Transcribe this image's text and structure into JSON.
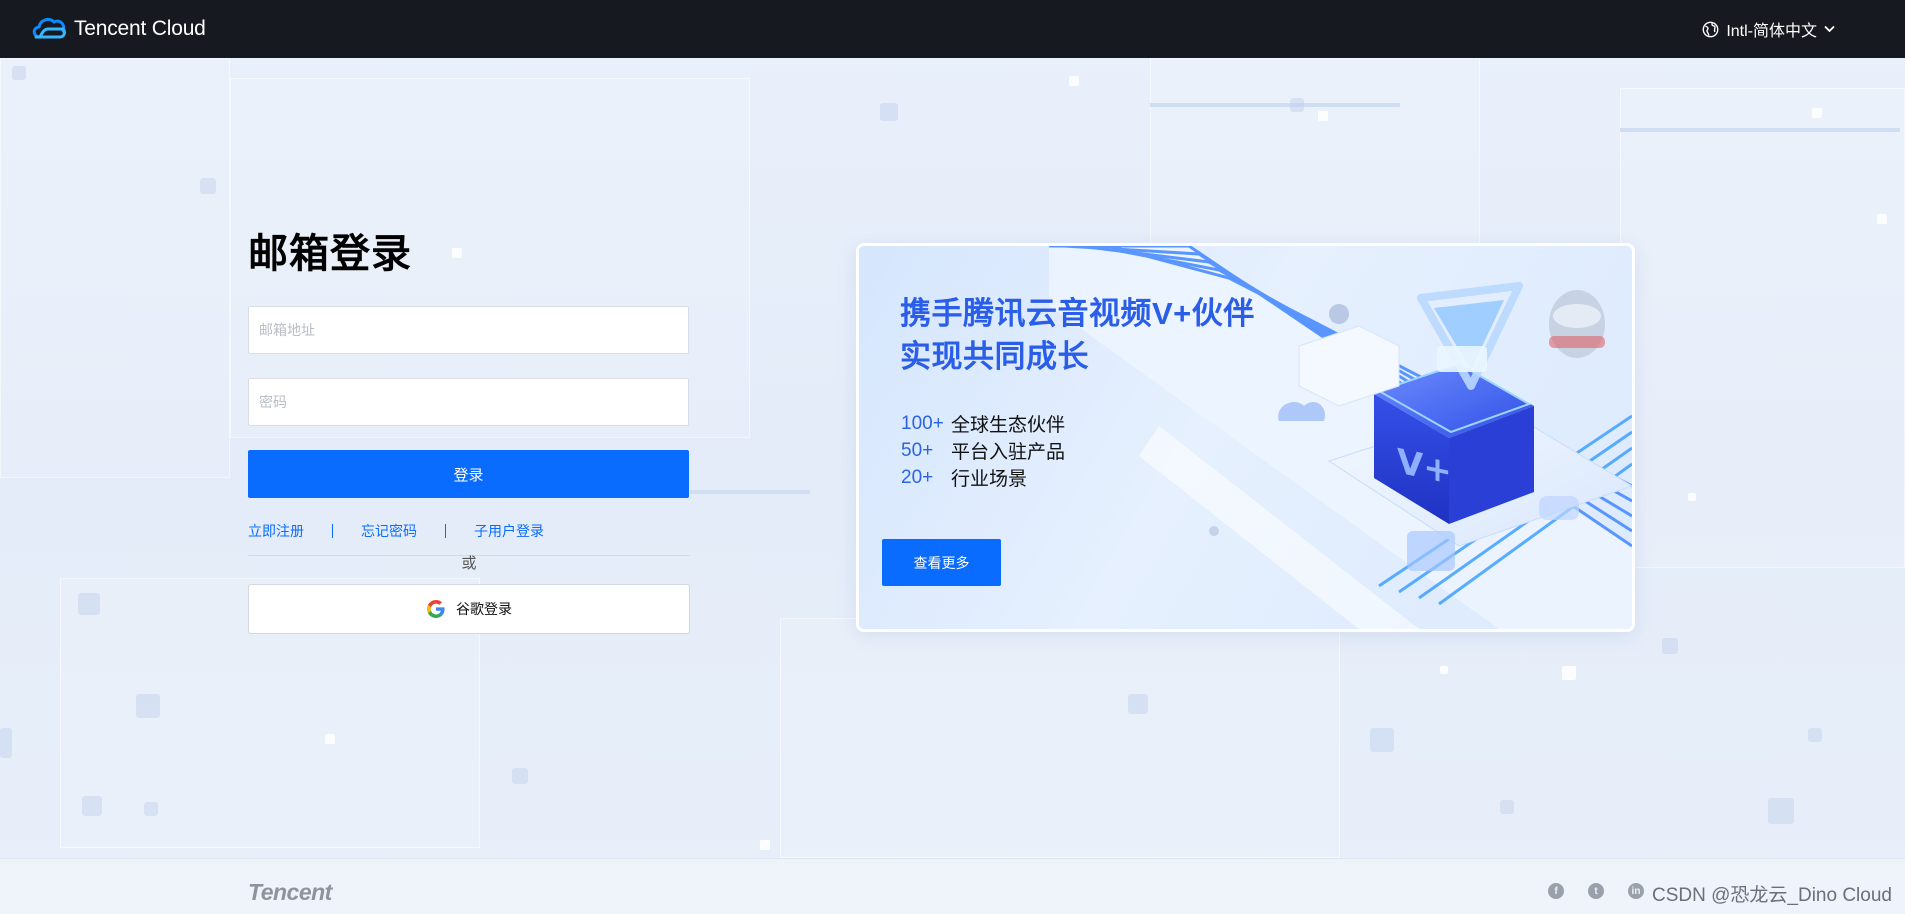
{
  "header": {
    "logo_text": "Tencent Cloud",
    "language_label": "Intl-简体中文"
  },
  "login": {
    "title": "邮箱登录",
    "email_placeholder": "邮箱地址",
    "email_value": "",
    "password_placeholder": "密码",
    "password_value": "",
    "submit_label": "登录",
    "links": {
      "register": "立即注册",
      "forgot": "忘记密码",
      "subuser": "子用户登录"
    },
    "or_text": "或",
    "google_label": "谷歌登录"
  },
  "banner": {
    "title_line1": "携手腾讯云音视频V+伙伴",
    "title_line2": "实现共同成长",
    "stats": [
      {
        "num": "100+",
        "label": "全球生态伙伴"
      },
      {
        "num": "50+",
        "label": "平台入驻产品"
      },
      {
        "num": "20+",
        "label": "行业场景"
      }
    ],
    "button_label": "查看更多"
  },
  "footer": {
    "brand": "Tencent",
    "social_icons": [
      "facebook-icon",
      "twitter-icon",
      "linkedin-icon"
    ],
    "watermark": "CSDN @恐龙云_Dino Cloud"
  },
  "colors": {
    "primary": "#0a6cff",
    "header_bg": "#16191f",
    "banner_title": "#2a5ee8"
  }
}
